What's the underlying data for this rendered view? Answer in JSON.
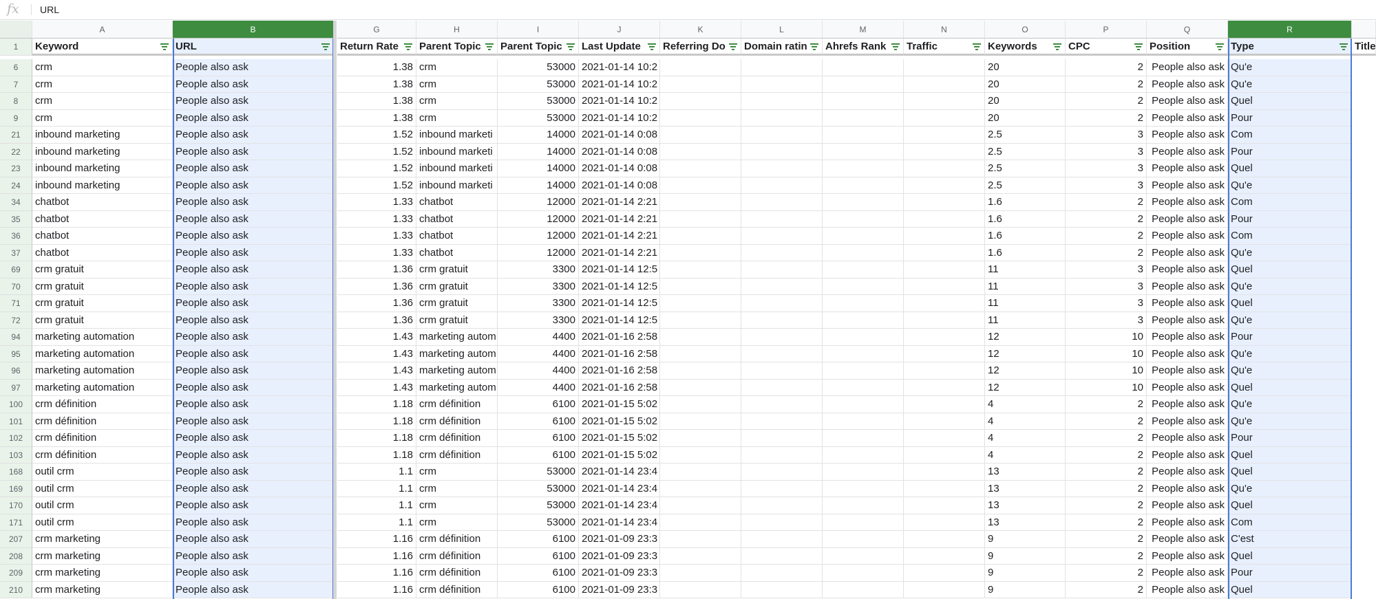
{
  "formula_bar": {
    "fx_label": "fx",
    "value": "URL"
  },
  "columns": [
    "A",
    "B",
    "G",
    "H",
    "I",
    "J",
    "K",
    "L",
    "M",
    "N",
    "O",
    "P",
    "Q",
    "R",
    ""
  ],
  "headers": [
    "Keyword",
    "URL",
    "Return Rate",
    "Parent Topic",
    "Parent Topic",
    "Last Update",
    "Referring Do",
    "Domain ratin",
    "Ahrefs Rank",
    "Traffic",
    "Keywords",
    "CPC",
    "Position",
    "Type",
    "Title"
  ],
  "header_row_number": "1",
  "rows": [
    [
      "6",
      "crm",
      "People also ask",
      "1.38",
      "crm",
      "53000",
      "2021-01-14 10:2",
      "",
      "",
      "",
      "",
      "20",
      "2",
      "People also ask",
      "Qu'e"
    ],
    [
      "7",
      "crm",
      "People also ask",
      "1.38",
      "crm",
      "53000",
      "2021-01-14 10:2",
      "",
      "",
      "",
      "",
      "20",
      "2",
      "People also ask",
      "Qu'e"
    ],
    [
      "8",
      "crm",
      "People also ask",
      "1.38",
      "crm",
      "53000",
      "2021-01-14 10:2",
      "",
      "",
      "",
      "",
      "20",
      "2",
      "People also ask",
      "Quel"
    ],
    [
      "9",
      "crm",
      "People also ask",
      "1.38",
      "crm",
      "53000",
      "2021-01-14 10:2",
      "",
      "",
      "",
      "",
      "20",
      "2",
      "People also ask",
      "Pour"
    ],
    [
      "21",
      "inbound marketing",
      "People also ask",
      "1.52",
      "inbound marketi",
      "14000",
      "2021-01-14 0:08",
      "",
      "",
      "",
      "",
      "2.5",
      "3",
      "People also ask",
      "Com"
    ],
    [
      "22",
      "inbound marketing",
      "People also ask",
      "1.52",
      "inbound marketi",
      "14000",
      "2021-01-14 0:08",
      "",
      "",
      "",
      "",
      "2.5",
      "3",
      "People also ask",
      "Pour"
    ],
    [
      "23",
      "inbound marketing",
      "People also ask",
      "1.52",
      "inbound marketi",
      "14000",
      "2021-01-14 0:08",
      "",
      "",
      "",
      "",
      "2.5",
      "3",
      "People also ask",
      "Quel"
    ],
    [
      "24",
      "inbound marketing",
      "People also ask",
      "1.52",
      "inbound marketi",
      "14000",
      "2021-01-14 0:08",
      "",
      "",
      "",
      "",
      "2.5",
      "3",
      "People also ask",
      "Qu'e"
    ],
    [
      "34",
      "chatbot",
      "People also ask",
      "1.33",
      "chatbot",
      "12000",
      "2021-01-14 2:21",
      "",
      "",
      "",
      "",
      "1.6",
      "2",
      "People also ask",
      "Com"
    ],
    [
      "35",
      "chatbot",
      "People also ask",
      "1.33",
      "chatbot",
      "12000",
      "2021-01-14 2:21",
      "",
      "",
      "",
      "",
      "1.6",
      "2",
      "People also ask",
      "Pour"
    ],
    [
      "36",
      "chatbot",
      "People also ask",
      "1.33",
      "chatbot",
      "12000",
      "2021-01-14 2:21",
      "",
      "",
      "",
      "",
      "1.6",
      "2",
      "People also ask",
      "Com"
    ],
    [
      "37",
      "chatbot",
      "People also ask",
      "1.33",
      "chatbot",
      "12000",
      "2021-01-14 2:21",
      "",
      "",
      "",
      "",
      "1.6",
      "2",
      "People also ask",
      "Qu'e"
    ],
    [
      "69",
      "crm gratuit",
      "People also ask",
      "1.36",
      "crm gratuit",
      "3300",
      "2021-01-14 12:5",
      "",
      "",
      "",
      "",
      "11",
      "3",
      "People also ask",
      "Quel"
    ],
    [
      "70",
      "crm gratuit",
      "People also ask",
      "1.36",
      "crm gratuit",
      "3300",
      "2021-01-14 12:5",
      "",
      "",
      "",
      "",
      "11",
      "3",
      "People also ask",
      "Qu'e"
    ],
    [
      "71",
      "crm gratuit",
      "People also ask",
      "1.36",
      "crm gratuit",
      "3300",
      "2021-01-14 12:5",
      "",
      "",
      "",
      "",
      "11",
      "3",
      "People also ask",
      "Quel"
    ],
    [
      "72",
      "crm gratuit",
      "People also ask",
      "1.36",
      "crm gratuit",
      "3300",
      "2021-01-14 12:5",
      "",
      "",
      "",
      "",
      "11",
      "3",
      "People also ask",
      "Qu'e"
    ],
    [
      "94",
      "marketing automation",
      "People also ask",
      "1.43",
      "marketing autom",
      "4400",
      "2021-01-16 2:58",
      "",
      "",
      "",
      "",
      "12",
      "10",
      "People also ask",
      "Pour"
    ],
    [
      "95",
      "marketing automation",
      "People also ask",
      "1.43",
      "marketing autom",
      "4400",
      "2021-01-16 2:58",
      "",
      "",
      "",
      "",
      "12",
      "10",
      "People also ask",
      "Qu'e"
    ],
    [
      "96",
      "marketing automation",
      "People also ask",
      "1.43",
      "marketing autom",
      "4400",
      "2021-01-16 2:58",
      "",
      "",
      "",
      "",
      "12",
      "10",
      "People also ask",
      "Qu'e"
    ],
    [
      "97",
      "marketing automation",
      "People also ask",
      "1.43",
      "marketing autom",
      "4400",
      "2021-01-16 2:58",
      "",
      "",
      "",
      "",
      "12",
      "10",
      "People also ask",
      "Quel"
    ],
    [
      "100",
      "crm définition",
      "People also ask",
      "1.18",
      "crm définition",
      "6100",
      "2021-01-15 5:02",
      "",
      "",
      "",
      "",
      "4",
      "2",
      "People also ask",
      "Qu'e"
    ],
    [
      "101",
      "crm définition",
      "People also ask",
      "1.18",
      "crm définition",
      "6100",
      "2021-01-15 5:02",
      "",
      "",
      "",
      "",
      "4",
      "2",
      "People also ask",
      "Qu'e"
    ],
    [
      "102",
      "crm définition",
      "People also ask",
      "1.18",
      "crm définition",
      "6100",
      "2021-01-15 5:02",
      "",
      "",
      "",
      "",
      "4",
      "2",
      "People also ask",
      "Pour"
    ],
    [
      "103",
      "crm définition",
      "People also ask",
      "1.18",
      "crm définition",
      "6100",
      "2021-01-15 5:02",
      "",
      "",
      "",
      "",
      "4",
      "2",
      "People also ask",
      "Quel"
    ],
    [
      "168",
      "outil crm",
      "People also ask",
      "1.1",
      "crm",
      "53000",
      "2021-01-14 23:4",
      "",
      "",
      "",
      "",
      "13",
      "2",
      "People also ask",
      "Quel"
    ],
    [
      "169",
      "outil crm",
      "People also ask",
      "1.1",
      "crm",
      "53000",
      "2021-01-14 23:4",
      "",
      "",
      "",
      "",
      "13",
      "2",
      "People also ask",
      "Qu'e"
    ],
    [
      "170",
      "outil crm",
      "People also ask",
      "1.1",
      "crm",
      "53000",
      "2021-01-14 23:4",
      "",
      "",
      "",
      "",
      "13",
      "2",
      "People also ask",
      "Quel"
    ],
    [
      "171",
      "outil crm",
      "People also ask",
      "1.1",
      "crm",
      "53000",
      "2021-01-14 23:4",
      "",
      "",
      "",
      "",
      "13",
      "2",
      "People also ask",
      "Com"
    ],
    [
      "207",
      "crm marketing",
      "People also ask",
      "1.16",
      "crm définition",
      "6100",
      "2021-01-09 23:3",
      "",
      "",
      "",
      "",
      "9",
      "2",
      "People also ask",
      "C'est"
    ],
    [
      "208",
      "crm marketing",
      "People also ask",
      "1.16",
      "crm définition",
      "6100",
      "2021-01-09 23:3",
      "",
      "",
      "",
      "",
      "9",
      "2",
      "People also ask",
      "Quel"
    ],
    [
      "209",
      "crm marketing",
      "People also ask",
      "1.16",
      "crm définition",
      "6100",
      "2021-01-09 23:3",
      "",
      "",
      "",
      "",
      "9",
      "2",
      "People also ask",
      "Pour"
    ],
    [
      "210",
      "crm marketing",
      "People also ask",
      "1.16",
      "crm définition",
      "6100",
      "2021-01-09 23:3",
      "",
      "",
      "",
      "",
      "9",
      "2",
      "People also ask",
      "Quel"
    ]
  ]
}
